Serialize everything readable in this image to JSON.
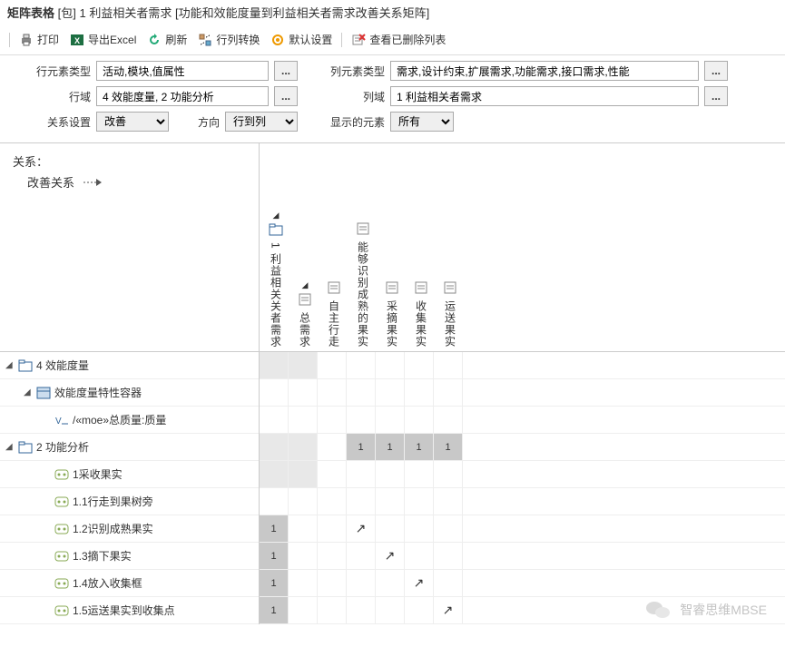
{
  "header": {
    "title": "矩阵表格",
    "scope": "[包] 1 利益相关者需求",
    "sub": "[功能和效能度量到利益相关者需求改善关系矩阵]"
  },
  "toolbar": {
    "print": "打印",
    "export": "导出Excel",
    "refresh": "刷新",
    "transpose": "行列转换",
    "defaults": "默认设置",
    "deleted": "查看已删除列表"
  },
  "filters": {
    "row_type_label": "行元素类型",
    "row_type_value": "活动,模块,值属性",
    "col_type_label": "列元素类型",
    "col_type_value": "需求,设计约束,扩展需求,功能需求,接口需求,性能",
    "row_domain_label": "行域",
    "row_domain_value": "4 效能度量, 2 功能分析",
    "col_domain_label": "列域",
    "col_domain_value": "1 利益相关者需求",
    "relation_label": "关系设置",
    "relation_value": "改善",
    "direction_label": "方向",
    "direction_value": "行到列",
    "display_label": "显示的元素",
    "display_value": "所有"
  },
  "legend": {
    "title": "关系：",
    "item": "改善关系"
  },
  "columns": [
    {
      "label": "1 利益相关关者需求",
      "tri": true,
      "icon": "pkg"
    },
    {
      "label": "总需求",
      "tri": true,
      "icon": "req"
    },
    {
      "label": "自主行走",
      "icon": "req"
    },
    {
      "label": "能够识别成熟的果实",
      "icon": "req"
    },
    {
      "label": "采摘果实",
      "icon": "req"
    },
    {
      "label": "收集果实",
      "icon": "req"
    },
    {
      "label": "运送果实",
      "icon": "req"
    }
  ],
  "rows": [
    {
      "level": 1,
      "exp": "▢",
      "icon": "pkg",
      "label": "4 效能度量",
      "cells": [
        "l",
        "l",
        "",
        "",
        "",
        "",
        ""
      ]
    },
    {
      "level": 2,
      "exp": "▢",
      "icon": "block",
      "label": "效能度量特性容器",
      "cells": [
        "",
        "",
        "",
        "",
        "",
        "",
        ""
      ]
    },
    {
      "level": 3,
      "icon": "val",
      "label": "/«moe»总质量:质量",
      "cells": [
        "",
        "",
        "",
        "",
        "",
        "",
        ""
      ]
    },
    {
      "level": 1,
      "exp": "▢",
      "icon": "pkg",
      "label": "2 功能分析",
      "cells": [
        "l",
        "l",
        "",
        "s1",
        "s1",
        "s1",
        "s1"
      ]
    },
    {
      "level": 3,
      "icon": "act",
      "label": "1采收果实",
      "cells": [
        "l",
        "l",
        "",
        "",
        "",
        "",
        ""
      ]
    },
    {
      "level": 3,
      "icon": "act",
      "label": "1.1行走到果树旁",
      "cells": [
        "",
        "",
        "",
        "",
        "",
        "",
        ""
      ]
    },
    {
      "level": 3,
      "icon": "act",
      "label": "1.2识别成熟果实",
      "cells": [
        "s1",
        "",
        "",
        "a",
        "",
        "",
        ""
      ]
    },
    {
      "level": 3,
      "icon": "act",
      "label": "1.3摘下果实",
      "cells": [
        "s1",
        "",
        "",
        "",
        "a",
        "",
        ""
      ]
    },
    {
      "level": 3,
      "icon": "act",
      "label": "1.4放入收集框",
      "cells": [
        "s1",
        "",
        "",
        "",
        "",
        "a",
        ""
      ]
    },
    {
      "level": 3,
      "icon": "act",
      "label": "1.5运送果实到收集点",
      "cells": [
        "s1",
        "",
        "",
        "",
        "",
        "",
        "a"
      ]
    }
  ],
  "watermark": "智睿思维MBSE"
}
